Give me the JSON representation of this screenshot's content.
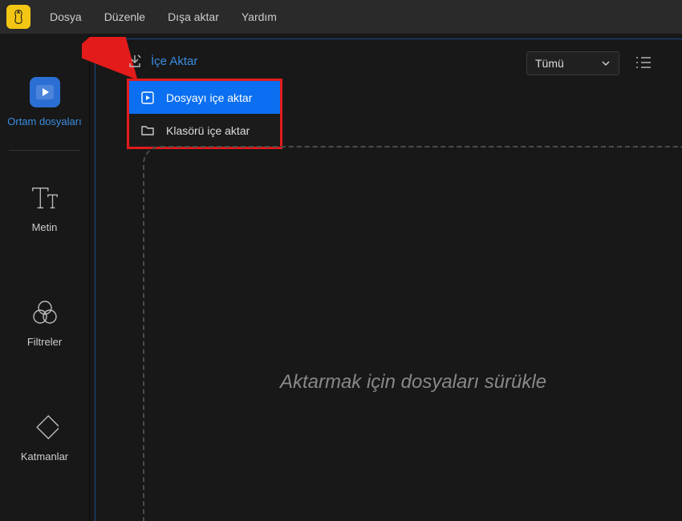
{
  "menubar": {
    "items": [
      "Dosya",
      "Düzenle",
      "Dışa aktar",
      "Yardım"
    ]
  },
  "sidebar": {
    "items": [
      {
        "label": "Ortam dosyaları",
        "icon": "media"
      },
      {
        "label": "Metin",
        "icon": "text"
      },
      {
        "label": "Filtreler",
        "icon": "filters"
      },
      {
        "label": "Katmanlar",
        "icon": "layers"
      }
    ]
  },
  "import": {
    "button_label": "İçe Aktar",
    "menu": [
      {
        "label": "Dosyayı içe aktar",
        "icon": "file-play"
      },
      {
        "label": "Klasörü içe aktar",
        "icon": "folder"
      }
    ]
  },
  "filter": {
    "selected": "Tümü"
  },
  "drop_zone": {
    "hint": "Aktarmak için dosyaları sürükle"
  }
}
